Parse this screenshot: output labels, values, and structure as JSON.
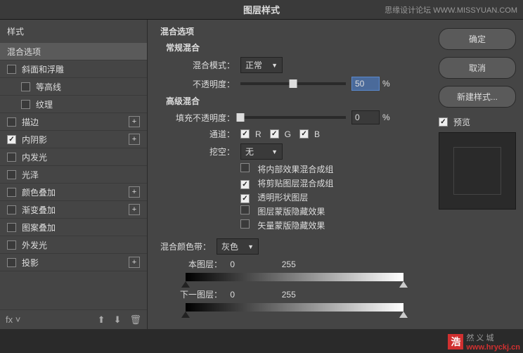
{
  "dialog_title": "图层样式",
  "watermark_top": "思缘设计论坛  WWW.MISSYUAN.COM",
  "sidebar": {
    "header": "样式",
    "items": [
      {
        "label": "混合选项",
        "checked": null,
        "selected": true,
        "plus": false,
        "indent": false
      },
      {
        "label": "斜面和浮雕",
        "checked": false,
        "plus": false,
        "indent": false
      },
      {
        "label": "等高线",
        "checked": false,
        "plus": false,
        "indent": true
      },
      {
        "label": "纹理",
        "checked": false,
        "plus": false,
        "indent": true
      },
      {
        "label": "描边",
        "checked": false,
        "plus": true,
        "indent": false
      },
      {
        "label": "内阴影",
        "checked": true,
        "plus": true,
        "indent": false
      },
      {
        "label": "内发光",
        "checked": false,
        "plus": false,
        "indent": false
      },
      {
        "label": "光泽",
        "checked": false,
        "plus": false,
        "indent": false
      },
      {
        "label": "颜色叠加",
        "checked": false,
        "plus": true,
        "indent": false
      },
      {
        "label": "渐变叠加",
        "checked": false,
        "plus": true,
        "indent": false
      },
      {
        "label": "图案叠加",
        "checked": false,
        "plus": false,
        "indent": false
      },
      {
        "label": "外发光",
        "checked": false,
        "plus": false,
        "indent": false
      },
      {
        "label": "投影",
        "checked": false,
        "plus": true,
        "indent": false
      }
    ]
  },
  "main": {
    "title": "混合选项",
    "general": {
      "title": "常规混合",
      "blend_mode_label": "混合模式：",
      "blend_mode_value": "正常",
      "opacity_label": "不透明度：",
      "opacity_value": "50",
      "opacity_unit": "%"
    },
    "advanced": {
      "title": "高级混合",
      "fill_label": "填充不透明度：",
      "fill_value": "0",
      "fill_unit": "%",
      "channels_label": "通道：",
      "ch_r": "R",
      "ch_g": "G",
      "ch_b": "B",
      "knockout_label": "挖空：",
      "knockout_value": "无",
      "opts": [
        {
          "label": "将内部效果混合成组",
          "checked": false
        },
        {
          "label": "将剪贴图层混合成组",
          "checked": true
        },
        {
          "label": "透明形状图层",
          "checked": true
        },
        {
          "label": "图层蒙版隐藏效果",
          "checked": false
        },
        {
          "label": "矢量蒙版隐藏效果",
          "checked": false
        }
      ]
    },
    "blendif": {
      "label": "混合颜色带：",
      "value": "灰色",
      "this_label": "本图层：",
      "this_lo": "0",
      "this_hi": "255",
      "under_label": "下一图层：",
      "under_lo": "0",
      "under_hi": "255"
    }
  },
  "right": {
    "ok": "确定",
    "cancel": "取消",
    "new_style": "新建样式...",
    "preview_label": "预览"
  },
  "wm_bottom": {
    "logo": "浩",
    "text": "然 义 城",
    "url": "www.hryckj.cn"
  }
}
